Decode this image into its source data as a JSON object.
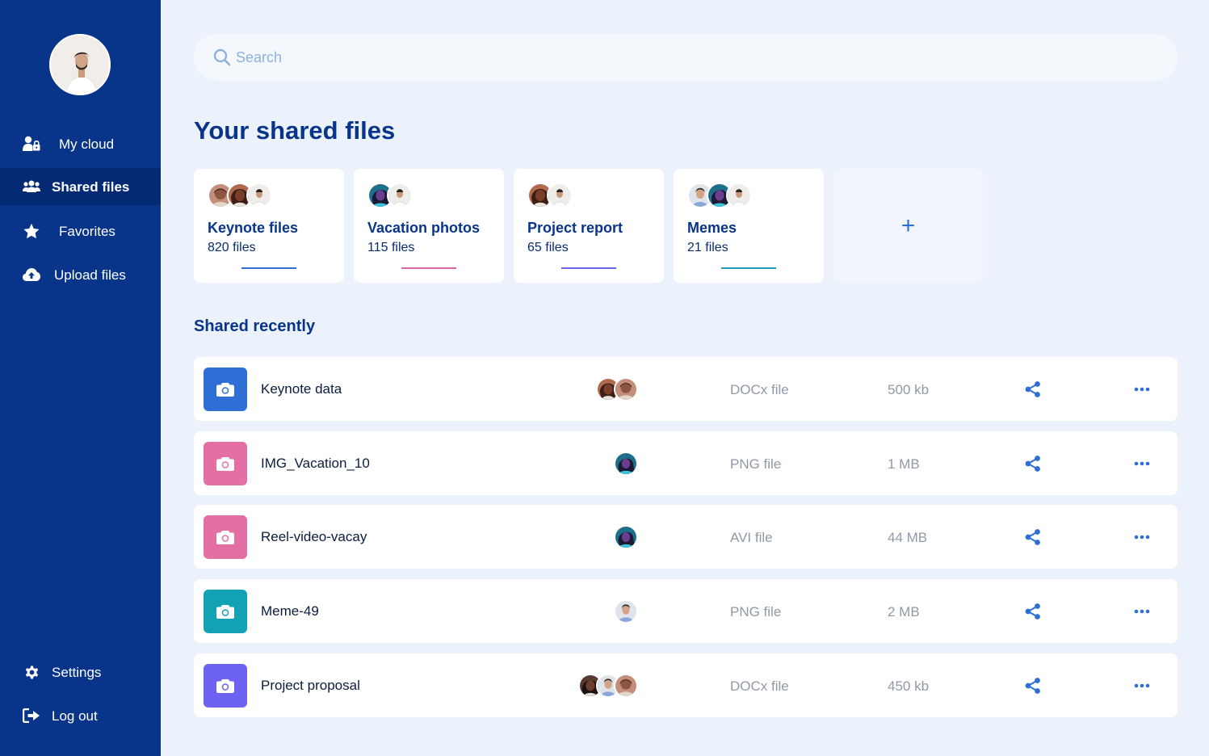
{
  "sidebar": {
    "nav": [
      {
        "label": "My cloud",
        "icon": "user-lock-icon",
        "active": false
      },
      {
        "label": "Shared files",
        "icon": "users-icon",
        "active": true
      },
      {
        "label": "Favorites",
        "icon": "star-icon",
        "active": false
      },
      {
        "label": "Upload files",
        "icon": "cloud-upload-icon",
        "active": false
      }
    ],
    "bottom": [
      {
        "label": "Settings",
        "icon": "gear-icon"
      },
      {
        "label": "Log out",
        "icon": "logout-icon"
      }
    ]
  },
  "search": {
    "placeholder": "Search"
  },
  "page_title": "Your shared files",
  "folders": [
    {
      "title": "Keynote files",
      "count": "820 files",
      "accent": "#2f6fd6"
    },
    {
      "title": "Vacation photos",
      "count": "115 files",
      "accent": "#e0679f"
    },
    {
      "title": "Project report",
      "count": "65 files",
      "accent": "#6b66f0"
    },
    {
      "title": "Memes",
      "count": "21 files",
      "accent": "#1f9fc0"
    }
  ],
  "add_folder_label": "+",
  "section_title": "Shared recently",
  "files": [
    {
      "name": "Keynote data",
      "type": "DOCx file",
      "size": "500 kb",
      "color": "#2d6fd5"
    },
    {
      "name": "IMG_Vacation_10",
      "type": "PNG file",
      "size": "1 MB",
      "color": "#e46fa5"
    },
    {
      "name": "Reel-video-vacay",
      "type": "AVI file",
      "size": "44 MB",
      "color": "#e46fa5"
    },
    {
      "name": "Meme-49",
      "type": "PNG file",
      "size": "2 MB",
      "color": "#12a2b4"
    },
    {
      "name": "Project proposal",
      "type": "DOCx file",
      "size": "450 kb",
      "color": "#6d62f2"
    }
  ]
}
